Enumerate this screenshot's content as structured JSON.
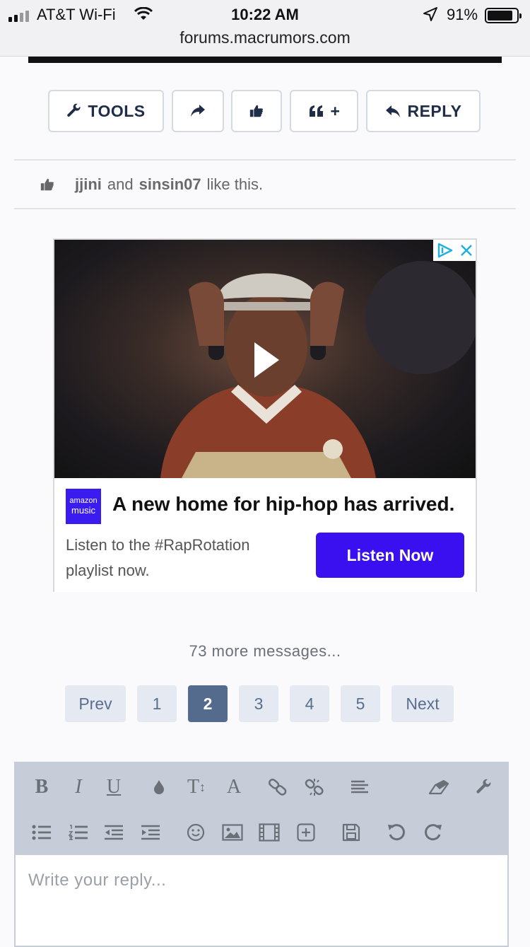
{
  "status_bar": {
    "carrier": "AT&T Wi-Fi",
    "time": "10:22 AM",
    "battery": "91%",
    "battery_level": 0.91,
    "url": "forums.macrumors.com"
  },
  "post_actions": {
    "tools_label": "TOOLS",
    "quote_label": "+",
    "reply_label": "REPLY"
  },
  "likes": {
    "user1": "jjini",
    "and": "and",
    "user2": "sinsin07",
    "suffix": "like this."
  },
  "ad": {
    "brand_line1": "amazon",
    "brand_line2": "music",
    "headline": "A new home for hip-hop has arrived.",
    "body": "Listen to the #RapRotation playlist now.",
    "cta": "Listen Now",
    "colors": {
      "cta": "#3a0ff0",
      "brand": "#3a1cf0"
    }
  },
  "thread": {
    "more_messages": "73 more messages..."
  },
  "pagination": {
    "prev": "Prev",
    "pages": [
      "1",
      "2",
      "3",
      "4",
      "5"
    ],
    "current": "2",
    "next": "Next"
  },
  "editor": {
    "bold": "B",
    "italic": "I",
    "underline": "U",
    "text_size": "T",
    "font": "A",
    "placeholder": "Write your reply..."
  }
}
